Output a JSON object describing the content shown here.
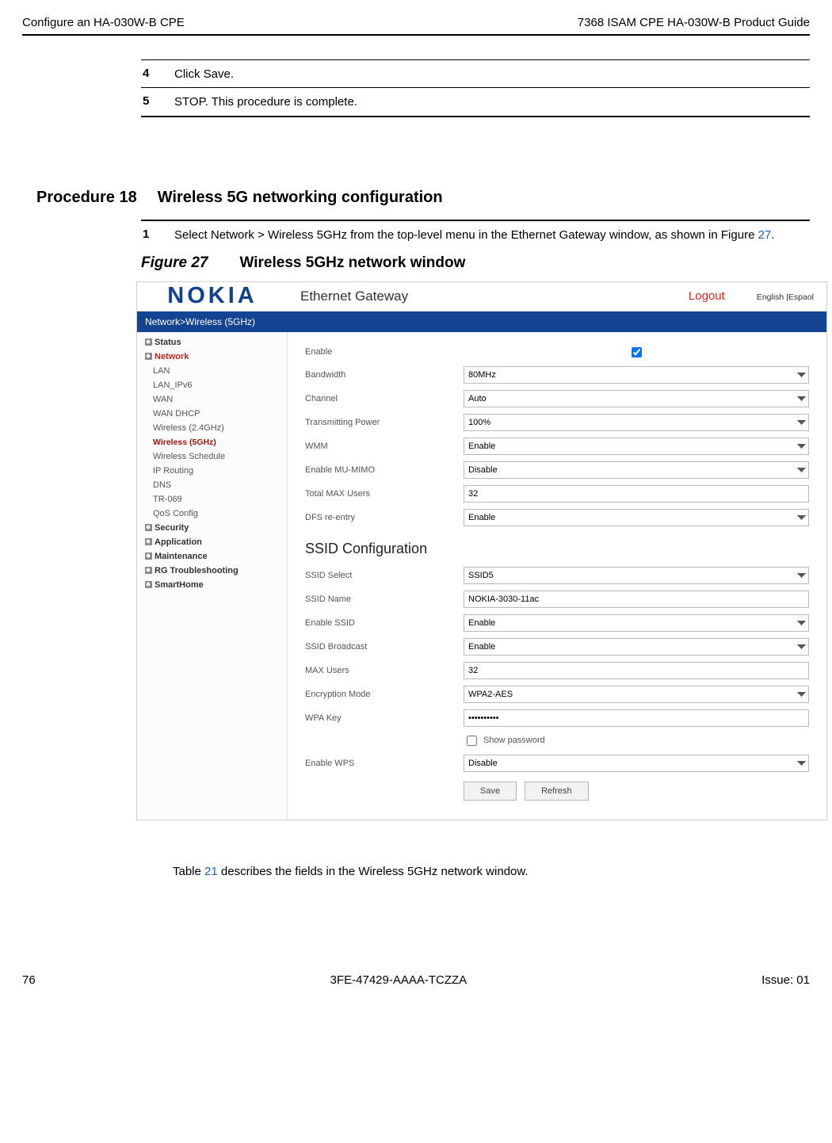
{
  "header": {
    "left": "Configure an HA-030W-B CPE",
    "right": "7368 ISAM CPE HA-030W-B Product Guide"
  },
  "steps": [
    {
      "num": "4",
      "text": "Click Save."
    },
    {
      "num": "5",
      "text": "STOP. This procedure is complete."
    }
  ],
  "procedure": {
    "label": "Procedure 18",
    "title": "Wireless 5G networking configuration"
  },
  "step1": {
    "num": "1",
    "text_pre": "Select Network > Wireless 5GHz from the top-level menu in the Ethernet Gateway window, as shown in Figure ",
    "fig_ref": "27",
    "text_post": "."
  },
  "figure": {
    "label": "Figure 27",
    "title": "Wireless 5GHz network window"
  },
  "shot": {
    "logo": "NOKIA",
    "title": "Ethernet Gateway",
    "logout": "Logout",
    "lang": "English |Espaol",
    "breadcrumb": "Network>Wireless (5GHz)",
    "sidebar": {
      "status": "Status",
      "network": "Network",
      "subs": {
        "lan": "LAN",
        "lan_ipv6": "LAN_IPv6",
        "wan": "WAN",
        "wan_dhcp": "WAN DHCP",
        "w24": "Wireless (2.4GHz)",
        "w5": "Wireless (5GHz)",
        "sched": "Wireless Schedule",
        "iprouting": "IP Routing",
        "dns": "DNS",
        "tr069": "TR-069",
        "qos": "QoS Config"
      },
      "security": "Security",
      "application": "Application",
      "maintenance": "Maintenance",
      "rg": "RG Troubleshooting",
      "smart": "SmartHome"
    },
    "form": {
      "enable_label": "Enable",
      "bandwidth_label": "Bandwidth",
      "bandwidth_val": "80MHz",
      "channel_label": "Channel",
      "channel_val": "Auto",
      "txpower_label": "Transmitting Power",
      "txpower_val": "100%",
      "wmm_label": "WMM",
      "wmm_val": "Enable",
      "mumimo_label": "Enable MU-MIMO",
      "mumimo_val": "Disable",
      "maxusers_label": "Total MAX Users",
      "maxusers_val": "32",
      "dfs_label": "DFS re-entry",
      "dfs_val": "Enable",
      "ssid_heading": "SSID Configuration",
      "ssid_select_label": "SSID Select",
      "ssid_select_val": "SSID5",
      "ssid_name_label": "SSID Name",
      "ssid_name_val": "NOKIA-3030-11ac",
      "enable_ssid_label": "Enable SSID",
      "enable_ssid_val": "Enable",
      "ssid_bcast_label": "SSID Broadcast",
      "ssid_bcast_val": "Enable",
      "ssid_maxusers_label": "MAX Users",
      "ssid_maxusers_val": "32",
      "enc_label": "Encryption Mode",
      "enc_val": "WPA2-AES",
      "wpa_label": "WPA Key",
      "wpa_val": "••••••••••",
      "showpw_label": "Show password",
      "wps_label": "Enable WPS",
      "wps_val": "Disable",
      "save_btn": "Save",
      "refresh_btn": "Refresh"
    }
  },
  "body_note": {
    "pre": "Table ",
    "ref": "21",
    "post": " describes the fields in the Wireless 5GHz network window."
  },
  "footer": {
    "left": "76",
    "center": "3FE-47429-AAAA-TCZZA",
    "right": "Issue: 01"
  }
}
